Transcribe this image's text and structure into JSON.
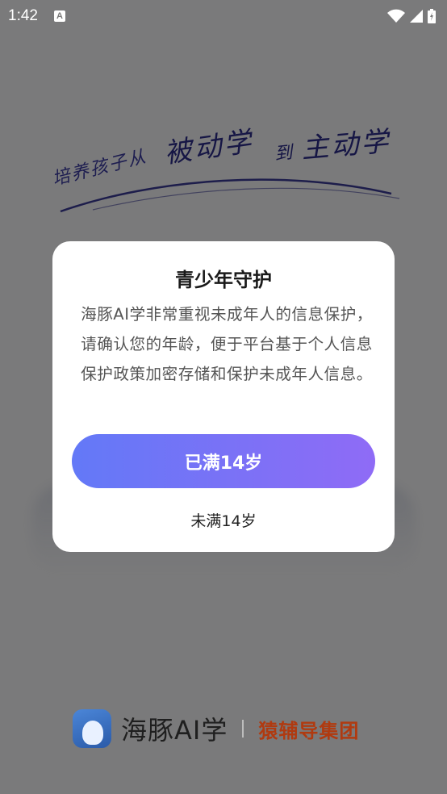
{
  "status_bar": {
    "time": "1:42",
    "notification_badge": "A",
    "icons": [
      "wifi-icon",
      "signal-icon",
      "battery-icon"
    ]
  },
  "splash": {
    "slogan_small": "培养孩子从",
    "slogan_big1": "被动学",
    "slogan_to": "到",
    "slogan_big2": "主动学",
    "brand_name": "海豚AI学",
    "brand_group": "猿辅导集团"
  },
  "dialog": {
    "title": "青少年守护",
    "body": "海豚AI学非常重视未成年人的信息保护，请确认您的年龄，便于平台基于个人信息保护政策加密存储和保护未成年人信息。",
    "confirm_label": "已满14岁",
    "decline_label": "未满14岁"
  },
  "colors": {
    "accent_start": "#6379f7",
    "accent_end": "#8f6bf6",
    "brand_group": "#b03a10",
    "slogan": "#2d2d8a"
  }
}
